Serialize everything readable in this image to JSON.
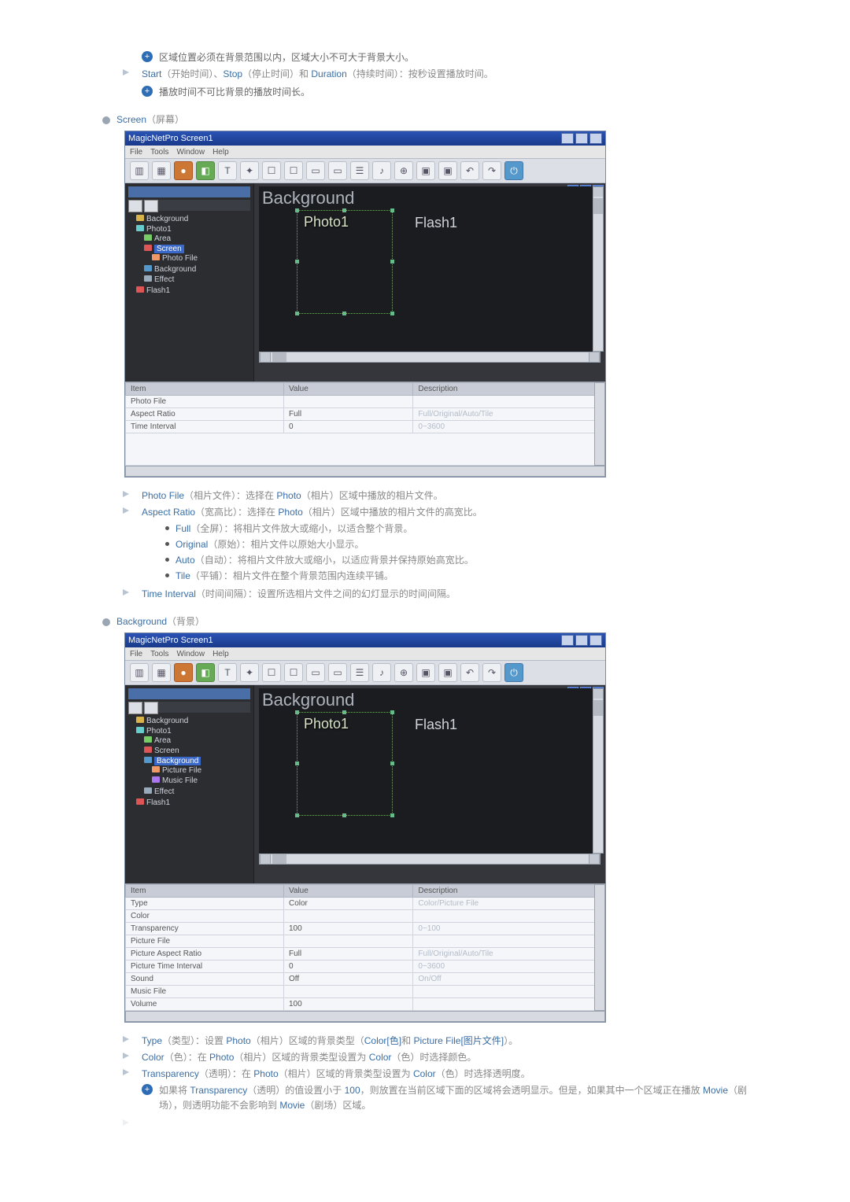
{
  "top_notes": {
    "note1": "区域位置必须在背景范围以内，区域大小不可大于背景大小。",
    "line2": {
      "start_term": "Start",
      "start_paren": "（开始时间）、",
      "stop_term": "Stop",
      "stop_paren": "（停止时间）和 ",
      "dur_term": "Duration",
      "dur_paren": "（持续时间）：按秒设置播放时间。"
    },
    "note2": "播放时间不可比背景的播放时间长。"
  },
  "section_screen": {
    "term": "Screen",
    "paren": "（屏幕）"
  },
  "section_background": {
    "term": "Background",
    "paren": "（背景）"
  },
  "app_common": {
    "title": "MagicNetPro Screen1",
    "menu": [
      "File",
      "Tools",
      "Window",
      "Help"
    ],
    "canvas_bg_label": "Background",
    "zone_photo": "Photo1",
    "zone_flash": "Flash1",
    "prop_headers": [
      "Item",
      "Value",
      "Description"
    ]
  },
  "screen_tree": [
    {
      "label": "Background",
      "ico": "ic-yellow"
    },
    {
      "label": "Photo1",
      "ico": "ic-cyan",
      "children": [
        {
          "label": "Area",
          "ico": "ic-green"
        },
        {
          "label": "Screen",
          "ico": "ic-red",
          "sel": true,
          "children": [
            {
              "label": "Photo File",
              "ico": "ic-orange"
            }
          ]
        },
        {
          "label": "Background",
          "ico": "ic-blue"
        },
        {
          "label": "Effect",
          "ico": "ic-dot"
        }
      ]
    },
    {
      "label": "Flash1",
      "ico": "ic-red"
    }
  ],
  "screen_props": [
    {
      "item": "Photo File",
      "value": "",
      "desc": ""
    },
    {
      "item": "Aspect Ratio",
      "value": "Full",
      "desc": "Full/Original/Auto/Tile"
    },
    {
      "item": "Time Interval",
      "value": "0",
      "desc": "0~3600"
    }
  ],
  "bg_tree": [
    {
      "label": "Background",
      "ico": "ic-yellow"
    },
    {
      "label": "Photo1",
      "ico": "ic-cyan",
      "children": [
        {
          "label": "Area",
          "ico": "ic-green"
        },
        {
          "label": "Screen",
          "ico": "ic-red"
        },
        {
          "label": "Background",
          "ico": "ic-blue",
          "sel": true,
          "children": [
            {
              "label": "Picture File",
              "ico": "ic-orange"
            },
            {
              "label": "Music File",
              "ico": "ic-purple"
            }
          ]
        },
        {
          "label": "Effect",
          "ico": "ic-dot"
        }
      ]
    },
    {
      "label": "Flash1",
      "ico": "ic-red"
    }
  ],
  "bg_props": [
    {
      "item": "Type",
      "value": "Color",
      "desc": "Color/Picture File"
    },
    {
      "item": "Color",
      "value": "",
      "desc": ""
    },
    {
      "item": "Transparency",
      "value": "100",
      "desc": "0~100"
    },
    {
      "item": "Picture File",
      "value": "",
      "desc": ""
    },
    {
      "item": "Picture Aspect Ratio",
      "value": "Full",
      "desc": "Full/Original/Auto/Tile"
    },
    {
      "item": "Picture Time Interval",
      "value": "0",
      "desc": "0~3600"
    },
    {
      "item": "Sound",
      "value": "Off",
      "desc": "On/Off"
    },
    {
      "item": "Music File",
      "value": "",
      "desc": ""
    },
    {
      "item": "Volume",
      "value": "100",
      "desc": ""
    }
  ],
  "screen_desc": {
    "photo_file": {
      "term": "Photo File",
      "paren": "（相片文件）：选择在 ",
      "term2": "Photo",
      "rest": "（相片）区域中播放的相片文件。"
    },
    "aspect_ratio": {
      "term": "Aspect Ratio",
      "paren": "（宽高比）：选择在 ",
      "term2": "Photo",
      "rest": "（相片）区域中播放的相片文件的高宽比。"
    },
    "full": {
      "term": "Full",
      "rest": "（全屏）：将相片文件放大或缩小，以适合整个背景。"
    },
    "original": {
      "term": "Original",
      "rest": "（原始）：相片文件以原始大小显示。"
    },
    "auto": {
      "term": "Auto",
      "rest": "（自动）：将相片文件放大或缩小，以适应背景并保持原始高宽比。"
    },
    "tile": {
      "term": "Tile",
      "rest": "（平铺）：相片文件在整个背景范围内连续平铺。"
    },
    "time_interval": {
      "term": "Time Interval",
      "rest": "（时间间隔）：设置所选相片文件之间的幻灯显示的时间间隔。"
    }
  },
  "bg_desc": {
    "type": {
      "term": "Type",
      "paren": "（类型）：设置 ",
      "term2": "Photo",
      "rest1": "（相片）区域的背景类型（",
      "opt1": "Color[色]",
      "and": "和 ",
      "opt2": "Picture File[图片文件]",
      "tail": "）。"
    },
    "color": {
      "term": "Color",
      "paren": "（色）：在 ",
      "term2": "Photo",
      "rest1": "（相片）区域的背景类型设置为 ",
      "term3": "Color",
      "rest2": "（色）时选择颜色。"
    },
    "transparency": {
      "term": "Transparency",
      "paren": "（透明）：在 ",
      "term2": "Photo",
      "rest1": "（相片）区域的背景类型设置为 ",
      "term3": "Color",
      "rest2": "（色）时选择透明度。"
    },
    "trans_note": {
      "pre": "如果将 ",
      "t1": "Transparency",
      "p1": "（透明）的值设置小于 ",
      "v": "100",
      "mid": "，则放置在当前区域下面的区域将会透明显示。但是，如果其中一个区域正在播放 ",
      "t2": "Movie",
      "p2": "（剧场），则透明功能不会影响到 ",
      "t3": "Movie",
      "p3": "（剧场）区域。"
    }
  }
}
